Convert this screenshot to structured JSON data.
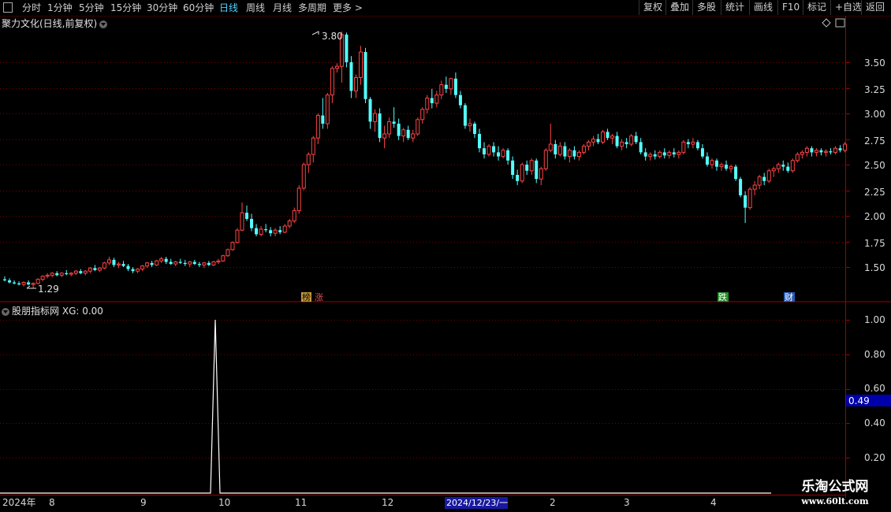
{
  "toolbar": {
    "periods": [
      "分时",
      "1分钟",
      "5分钟",
      "15分钟",
      "30分钟",
      "60分钟",
      "日线",
      "周线",
      "月线",
      "多周期",
      "更多 >"
    ],
    "active_period": "日线",
    "right_buttons": [
      "复权",
      "叠加",
      "多股",
      "统计",
      "画线",
      "F10",
      "标记",
      "+自选",
      "返回"
    ]
  },
  "main_panel": {
    "title": "聚力文化(日线,前复权)",
    "high_label": "3.80",
    "low_label": "1.29",
    "y_ticks": [
      "3.50",
      "3.25",
      "3.00",
      "2.75",
      "2.50",
      "2.25",
      "2.00",
      "1.75",
      "1.50"
    ],
    "event_markers": [
      {
        "text": "榜",
        "color": "#c89a3c"
      },
      {
        "text": "涨",
        "color": "#e05050"
      },
      {
        "text": "跌",
        "color": "#3ca83c"
      },
      {
        "text": "财",
        "color": "#3c7cd8"
      }
    ]
  },
  "indicator_panel": {
    "title": "股朋指标网",
    "value_label": "XG: 0.00",
    "y_ticks": [
      "1.00",
      "0.80",
      "0.60",
      "0.40",
      "0.20"
    ],
    "cursor_value": "0.49"
  },
  "x_axis": {
    "labels": [
      "2024年",
      "8",
      "9",
      "10",
      "11",
      "12",
      "2024/12/23/一",
      "2",
      "3",
      "4"
    ]
  },
  "watermark": {
    "line1": "乐淘公式网",
    "line2": "www.60lt.com"
  },
  "colors": {
    "up": "#ff4444",
    "down": "#54ffff",
    "grid": "#7a0000",
    "axis": "#a00000",
    "cursor_bg": "#0000aa",
    "highlight_date_bg": "#1818a0"
  },
  "chart_data": {
    "type": "candlestick",
    "ylim": [
      1.25,
      3.85
    ],
    "indicator": {
      "name": "XG",
      "ylim": [
        0,
        1.1
      ],
      "spike_index": 71,
      "spike_value": 1.0
    },
    "candles": [
      [
        1.38,
        1.41,
        1.36,
        1.37
      ],
      [
        1.37,
        1.39,
        1.34,
        1.35
      ],
      [
        1.35,
        1.37,
        1.33,
        1.34
      ],
      [
        1.34,
        1.36,
        1.32,
        1.33
      ],
      [
        1.33,
        1.36,
        1.31,
        1.35
      ],
      [
        1.35,
        1.37,
        1.32,
        1.33
      ],
      [
        1.33,
        1.35,
        1.29,
        1.34
      ],
      [
        1.34,
        1.39,
        1.33,
        1.38
      ],
      [
        1.38,
        1.42,
        1.36,
        1.41
      ],
      [
        1.41,
        1.44,
        1.39,
        1.42
      ],
      [
        1.42,
        1.45,
        1.4,
        1.44
      ],
      [
        1.44,
        1.46,
        1.41,
        1.42
      ],
      [
        1.42,
        1.45,
        1.4,
        1.44
      ],
      [
        1.44,
        1.47,
        1.42,
        1.43
      ],
      [
        1.43,
        1.45,
        1.41,
        1.44
      ],
      [
        1.44,
        1.47,
        1.42,
        1.46
      ],
      [
        1.46,
        1.48,
        1.43,
        1.44
      ],
      [
        1.44,
        1.47,
        1.42,
        1.46
      ],
      [
        1.46,
        1.5,
        1.44,
        1.49
      ],
      [
        1.49,
        1.52,
        1.46,
        1.47
      ],
      [
        1.47,
        1.5,
        1.45,
        1.49
      ],
      [
        1.49,
        1.55,
        1.48,
        1.54
      ],
      [
        1.54,
        1.6,
        1.52,
        1.57
      ],
      [
        1.57,
        1.59,
        1.5,
        1.52
      ],
      [
        1.52,
        1.55,
        1.49,
        1.53
      ],
      [
        1.53,
        1.56,
        1.5,
        1.51
      ],
      [
        1.51,
        1.53,
        1.46,
        1.48
      ],
      [
        1.48,
        1.5,
        1.44,
        1.46
      ],
      [
        1.46,
        1.49,
        1.44,
        1.48
      ],
      [
        1.48,
        1.52,
        1.46,
        1.51
      ],
      [
        1.51,
        1.55,
        1.49,
        1.54
      ],
      [
        1.54,
        1.56,
        1.5,
        1.52
      ],
      [
        1.52,
        1.57,
        1.51,
        1.56
      ],
      [
        1.56,
        1.6,
        1.54,
        1.58
      ],
      [
        1.58,
        1.6,
        1.53,
        1.55
      ],
      [
        1.55,
        1.58,
        1.52,
        1.53
      ],
      [
        1.53,
        1.56,
        1.51,
        1.55
      ],
      [
        1.55,
        1.58,
        1.53,
        1.54
      ],
      [
        1.54,
        1.57,
        1.51,
        1.53
      ],
      [
        1.53,
        1.56,
        1.5,
        1.55
      ],
      [
        1.55,
        1.57,
        1.52,
        1.53
      ],
      [
        1.53,
        1.55,
        1.5,
        1.52
      ],
      [
        1.52,
        1.55,
        1.49,
        1.54
      ],
      [
        1.54,
        1.56,
        1.51,
        1.52
      ],
      [
        1.52,
        1.56,
        1.51,
        1.55
      ],
      [
        1.55,
        1.58,
        1.53,
        1.56
      ],
      [
        1.56,
        1.62,
        1.55,
        1.61
      ],
      [
        1.61,
        1.68,
        1.6,
        1.67
      ],
      [
        1.67,
        1.75,
        1.66,
        1.74
      ],
      [
        1.74,
        1.88,
        1.73,
        1.86
      ],
      [
        1.86,
        2.13,
        1.85,
        2.03
      ],
      [
        2.03,
        2.1,
        1.95,
        1.97
      ],
      [
        1.97,
        2.02,
        1.85,
        1.88
      ],
      [
        1.88,
        1.92,
        1.8,
        1.82
      ],
      [
        1.82,
        1.9,
        1.8,
        1.87
      ],
      [
        1.87,
        1.92,
        1.84,
        1.86
      ],
      [
        1.86,
        1.89,
        1.8,
        1.83
      ],
      [
        1.83,
        1.88,
        1.8,
        1.86
      ],
      [
        1.86,
        1.9,
        1.82,
        1.84
      ],
      [
        1.84,
        1.92,
        1.83,
        1.9
      ],
      [
        1.9,
        1.97,
        1.88,
        1.95
      ],
      [
        1.95,
        2.08,
        1.93,
        2.05
      ],
      [
        2.05,
        2.3,
        2.02,
        2.27
      ],
      [
        2.27,
        2.52,
        2.25,
        2.5
      ],
      [
        2.5,
        2.62,
        2.42,
        2.6
      ],
      [
        2.6,
        2.78,
        2.52,
        2.76
      ],
      [
        2.76,
        3.0,
        2.7,
        2.98
      ],
      [
        2.98,
        3.15,
        2.85,
        2.9
      ],
      [
        2.9,
        3.2,
        2.85,
        3.18
      ],
      [
        3.18,
        3.46,
        3.1,
        3.44
      ],
      [
        3.44,
        3.49,
        3.4,
        3.46
      ],
      [
        3.46,
        3.8,
        3.3,
        3.77
      ],
      [
        3.77,
        3.79,
        3.45,
        3.5
      ],
      [
        3.5,
        3.56,
        3.15,
        3.22
      ],
      [
        3.22,
        3.38,
        3.15,
        3.35
      ],
      [
        3.35,
        3.66,
        3.28,
        3.6
      ],
      [
        3.6,
        3.64,
        3.1,
        3.14
      ],
      [
        3.14,
        3.16,
        2.85,
        2.92
      ],
      [
        2.92,
        3.04,
        2.82,
        3.0
      ],
      [
        3.0,
        3.05,
        2.72,
        2.76
      ],
      [
        2.76,
        2.88,
        2.66,
        2.8
      ],
      [
        2.8,
        2.96,
        2.76,
        2.92
      ],
      [
        2.92,
        3.06,
        2.86,
        2.9
      ],
      [
        2.9,
        2.95,
        2.74,
        2.78
      ],
      [
        2.78,
        2.86,
        2.72,
        2.84
      ],
      [
        2.84,
        2.88,
        2.74,
        2.76
      ],
      [
        2.76,
        2.84,
        2.72,
        2.8
      ],
      [
        2.8,
        2.96,
        2.78,
        2.94
      ],
      [
        2.94,
        3.06,
        2.9,
        3.04
      ],
      [
        3.04,
        3.18,
        3.0,
        3.15
      ],
      [
        3.15,
        3.24,
        3.05,
        3.1
      ],
      [
        3.1,
        3.22,
        3.06,
        3.18
      ],
      [
        3.18,
        3.32,
        3.14,
        3.28
      ],
      [
        3.28,
        3.36,
        3.2,
        3.24
      ],
      [
        3.24,
        3.35,
        3.18,
        3.34
      ],
      [
        3.34,
        3.4,
        3.15,
        3.18
      ],
      [
        3.18,
        3.22,
        3.05,
        3.08
      ],
      [
        3.08,
        3.1,
        2.85,
        2.88
      ],
      [
        2.88,
        2.95,
        2.82,
        2.9
      ],
      [
        2.9,
        2.92,
        2.76,
        2.8
      ],
      [
        2.8,
        2.85,
        2.62,
        2.66
      ],
      [
        2.66,
        2.72,
        2.56,
        2.6
      ],
      [
        2.6,
        2.7,
        2.58,
        2.68
      ],
      [
        2.68,
        2.72,
        2.58,
        2.62
      ],
      [
        2.62,
        2.68,
        2.54,
        2.58
      ],
      [
        2.58,
        2.66,
        2.56,
        2.64
      ],
      [
        2.64,
        2.66,
        2.5,
        2.54
      ],
      [
        2.54,
        2.58,
        2.36,
        2.4
      ],
      [
        2.4,
        2.45,
        2.3,
        2.34
      ],
      [
        2.34,
        2.52,
        2.32,
        2.5
      ],
      [
        2.5,
        2.54,
        2.4,
        2.44
      ],
      [
        2.44,
        2.56,
        2.4,
        2.54
      ],
      [
        2.54,
        2.56,
        2.32,
        2.36
      ],
      [
        2.36,
        2.48,
        2.3,
        2.46
      ],
      [
        2.46,
        2.66,
        2.44,
        2.64
      ],
      [
        2.64,
        2.9,
        2.62,
        2.7
      ],
      [
        2.7,
        2.74,
        2.56,
        2.6
      ],
      [
        2.6,
        2.72,
        2.58,
        2.68
      ],
      [
        2.68,
        2.72,
        2.55,
        2.58
      ],
      [
        2.58,
        2.66,
        2.52,
        2.64
      ],
      [
        2.64,
        2.68,
        2.55,
        2.58
      ],
      [
        2.58,
        2.64,
        2.54,
        2.62
      ],
      [
        2.62,
        2.7,
        2.6,
        2.68
      ],
      [
        2.68,
        2.74,
        2.64,
        2.72
      ],
      [
        2.72,
        2.78,
        2.68,
        2.75
      ],
      [
        2.75,
        2.8,
        2.7,
        2.72
      ],
      [
        2.72,
        2.84,
        2.7,
        2.82
      ],
      [
        2.82,
        2.85,
        2.74,
        2.76
      ],
      [
        2.76,
        2.8,
        2.7,
        2.78
      ],
      [
        2.78,
        2.82,
        2.66,
        2.68
      ],
      [
        2.68,
        2.75,
        2.64,
        2.72
      ],
      [
        2.72,
        2.76,
        2.66,
        2.7
      ],
      [
        2.7,
        2.8,
        2.68,
        2.78
      ],
      [
        2.78,
        2.82,
        2.7,
        2.72
      ],
      [
        2.72,
        2.76,
        2.6,
        2.62
      ],
      [
        2.62,
        2.66,
        2.54,
        2.58
      ],
      [
        2.58,
        2.62,
        2.54,
        2.6
      ],
      [
        2.6,
        2.64,
        2.55,
        2.58
      ],
      [
        2.58,
        2.64,
        2.56,
        2.62
      ],
      [
        2.62,
        2.66,
        2.56,
        2.59
      ],
      [
        2.59,
        2.64,
        2.56,
        2.62
      ],
      [
        2.62,
        2.66,
        2.57,
        2.6
      ],
      [
        2.6,
        2.64,
        2.56,
        2.62
      ],
      [
        2.62,
        2.74,
        2.6,
        2.72
      ],
      [
        2.72,
        2.75,
        2.66,
        2.7
      ],
      [
        2.7,
        2.76,
        2.66,
        2.72
      ],
      [
        2.72,
        2.74,
        2.64,
        2.66
      ],
      [
        2.66,
        2.7,
        2.56,
        2.58
      ],
      [
        2.58,
        2.62,
        2.48,
        2.5
      ],
      [
        2.5,
        2.56,
        2.46,
        2.54
      ],
      [
        2.54,
        2.56,
        2.44,
        2.48
      ],
      [
        2.48,
        2.52,
        2.44,
        2.5
      ],
      [
        2.5,
        2.54,
        2.44,
        2.46
      ],
      [
        2.46,
        2.5,
        2.42,
        2.48
      ],
      [
        2.48,
        2.5,
        2.34,
        2.36
      ],
      [
        2.36,
        2.38,
        2.18,
        2.2
      ],
      [
        2.2,
        2.24,
        1.93,
        2.08
      ],
      [
        2.08,
        2.28,
        2.06,
        2.26
      ],
      [
        2.26,
        2.34,
        2.2,
        2.3
      ],
      [
        2.3,
        2.4,
        2.26,
        2.38
      ],
      [
        2.38,
        2.42,
        2.3,
        2.34
      ],
      [
        2.34,
        2.46,
        2.32,
        2.44
      ],
      [
        2.44,
        2.48,
        2.38,
        2.46
      ],
      [
        2.46,
        2.52,
        2.42,
        2.5
      ],
      [
        2.5,
        2.54,
        2.44,
        2.48
      ],
      [
        2.48,
        2.52,
        2.42,
        2.44
      ],
      [
        2.44,
        2.56,
        2.42,
        2.54
      ],
      [
        2.54,
        2.62,
        2.52,
        2.6
      ],
      [
        2.6,
        2.64,
        2.56,
        2.62
      ],
      [
        2.62,
        2.68,
        2.58,
        2.66
      ],
      [
        2.66,
        2.68,
        2.58,
        2.62
      ],
      [
        2.62,
        2.66,
        2.58,
        2.64
      ],
      [
        2.64,
        2.66,
        2.59,
        2.62
      ],
      [
        2.62,
        2.65,
        2.58,
        2.63
      ],
      [
        2.63,
        2.66,
        2.6,
        2.62
      ],
      [
        2.62,
        2.68,
        2.6,
        2.66
      ],
      [
        2.66,
        2.69,
        2.62,
        2.64
      ],
      [
        2.64,
        2.72,
        2.62,
        2.7
      ]
    ]
  }
}
